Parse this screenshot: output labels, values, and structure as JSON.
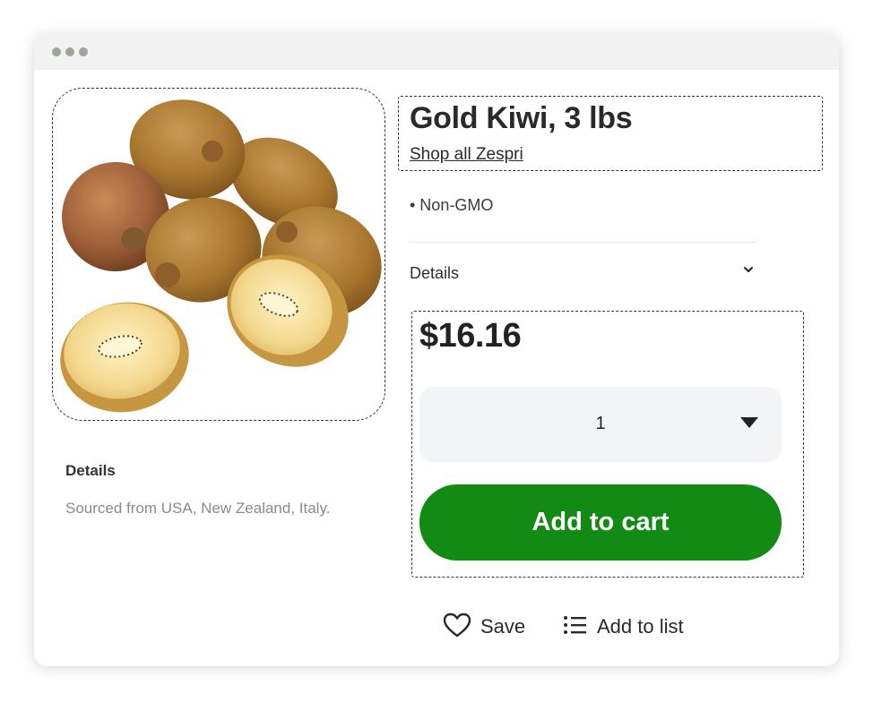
{
  "window": {
    "controls": [
      "dot-1",
      "dot-2",
      "dot-3"
    ]
  },
  "product": {
    "image_alt": "Gold kiwi fruits, whole and halved",
    "title": "Gold Kiwi, 3 lbs",
    "brand_link": "Shop all Zespri",
    "bullets": [
      "• Non-GMO"
    ],
    "details_toggle_label": "Details",
    "price": "$16.16",
    "quantity": "1",
    "add_to_cart_label": "Add to cart",
    "save_label": "Save",
    "add_to_list_label": "Add to list"
  },
  "left_details": {
    "title": "Details",
    "text": "Sourced from USA, New Zealand, Italy."
  },
  "colors": {
    "accent_green": "#138a13",
    "qty_bg": "#f3f4f6",
    "titlebar_bg": "#f2f2f2",
    "window_dots": "#9ea59a"
  },
  "icons": {
    "details_chevron": "chevron-down-icon",
    "quantity_arrow": "caret-down-icon",
    "save": "heart-icon",
    "add_to_list": "list-icon"
  }
}
